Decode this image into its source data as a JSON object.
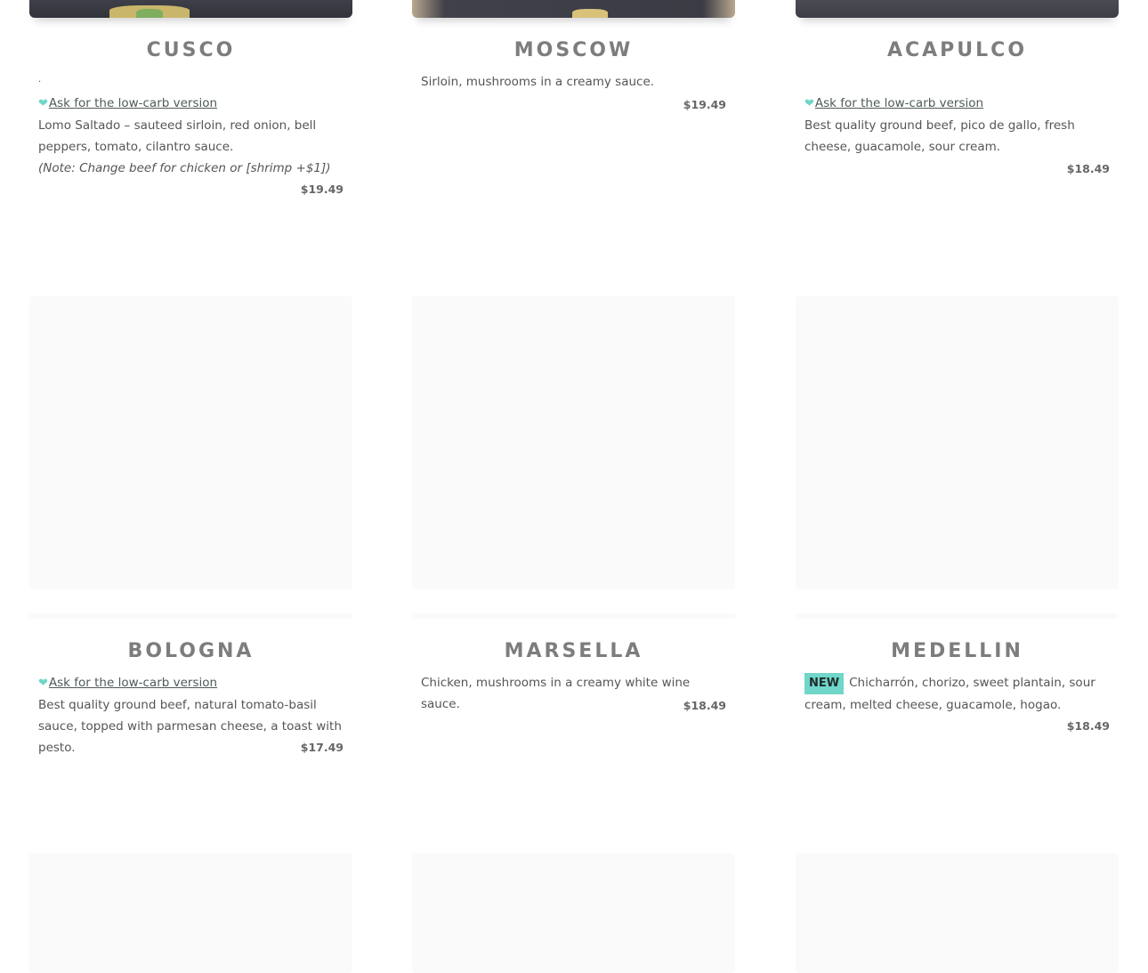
{
  "dishes": {
    "cusco": {
      "name": "CUSCO",
      "marker": ".",
      "lowcarb": "Ask for the low-carb version",
      "desc": "Lomo Saltado – sauteed sirloin, red onion, bell peppers, tomato, cilantro sauce.",
      "note": "(Note: Change beef for chicken or [shrimp +$1])",
      "price": "$19.49"
    },
    "moscow": {
      "name": "MOSCOW",
      "desc": "Sirloin, mushrooms in a creamy sauce.",
      "price": "$19.49"
    },
    "acapulco": {
      "name": "ACAPULCO",
      "lowcarb": "Ask for the low-carb version",
      "desc": "Best quality ground beef, pico de gallo, fresh cheese, guacamole, sour cream.",
      "price": "$18.49"
    },
    "bologna": {
      "name": "BOLOGNA",
      "lowcarb": "Ask for the low-carb version",
      "desc": "Best quality ground beef, natural tomato-basil sauce, topped with parmesan cheese, a toast with pesto.",
      "price": "$17.49"
    },
    "marsella": {
      "name": "MARSELLA",
      "desc": "Chicken, mushrooms in a creamy white wine sauce.",
      "price": "$18.49"
    },
    "medellin": {
      "name": "MEDELLIN",
      "badge": "NEW",
      "desc": "Chicharrón, chorizo, sweet plantain, sour cream, melted cheese, guacamole, hogao.",
      "price": "$18.49"
    }
  },
  "icons": {
    "lowcarb": "heart-icon"
  },
  "colors": {
    "accent": "#6fd6c9",
    "title": "#7d7d7d"
  }
}
